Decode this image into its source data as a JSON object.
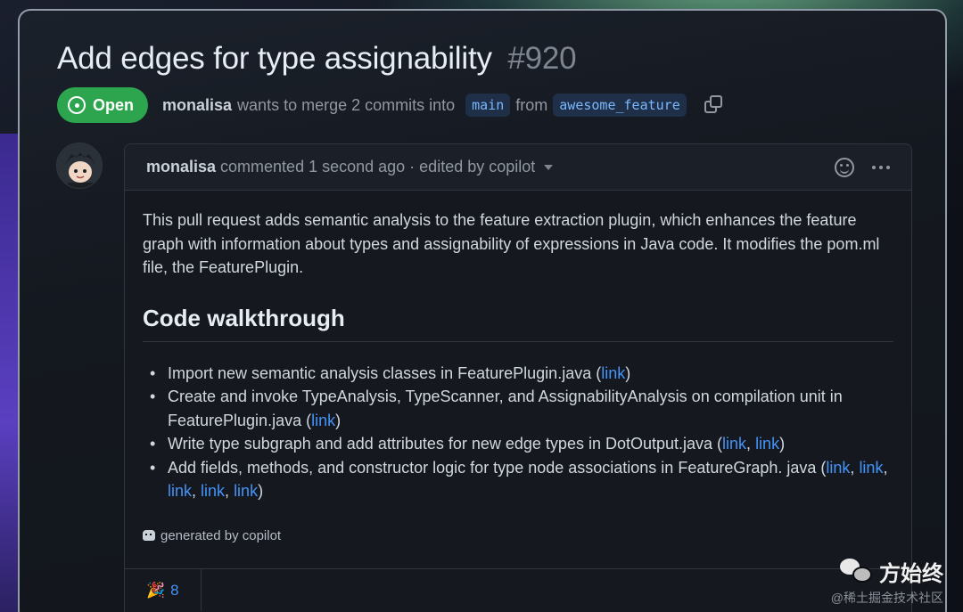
{
  "pr": {
    "title": "Add edges for type assignability",
    "number": "#920",
    "status": "Open",
    "author": "monalisa",
    "merge_text": "wants to merge 2 commits into",
    "base_branch": "main",
    "from_text": "from",
    "head_branch": "awesome_feature"
  },
  "comment": {
    "author": "monalisa",
    "meta": "commented 1 second ago",
    "edited": "· edited by copilot",
    "summary": "This pull request adds semantic analysis to the feature extraction plugin, which enhances the feature graph with information about types and assignability of expressions in Java code. It modifies the pom.ml file, the FeaturePlugin.",
    "heading": "Code walkthrough",
    "items": [
      {
        "text": "Import new semantic analysis classes in FeaturePlugin.java (",
        "links": [
          "link"
        ],
        "close": ")"
      },
      {
        "text": "Create and invoke TypeAnalysis, TypeScanner, and AssignabilityAnalysis on compilation unit in FeaturePlugin.java (",
        "links": [
          "link"
        ],
        "close": ")"
      },
      {
        "text": "Write type subgraph and add attributes for new edge types in DotOutput.java (",
        "links": [
          "link",
          "link"
        ],
        "close": ")"
      },
      {
        "text": "Add fields, methods, and constructor logic for type node associations in FeatureGraph. java (",
        "links": [
          "link",
          "link",
          "link",
          "link",
          "link"
        ],
        "close": ")"
      }
    ],
    "generated": "generated by copilot",
    "reaction_emoji": "🎉",
    "reaction_count": "8"
  },
  "watermark": {
    "name": "方始终",
    "sub": "@稀土掘金技术社区"
  },
  "icons": {
    "status": "open-circle-icon",
    "copy": "copy-icon",
    "reaction_add": "smiley-icon",
    "more": "kebab-icon",
    "bot": "copilot-icon"
  },
  "colors": {
    "open_green": "#2da44e",
    "link_blue": "#4493f8",
    "branch_bg": "#1f2f47"
  }
}
